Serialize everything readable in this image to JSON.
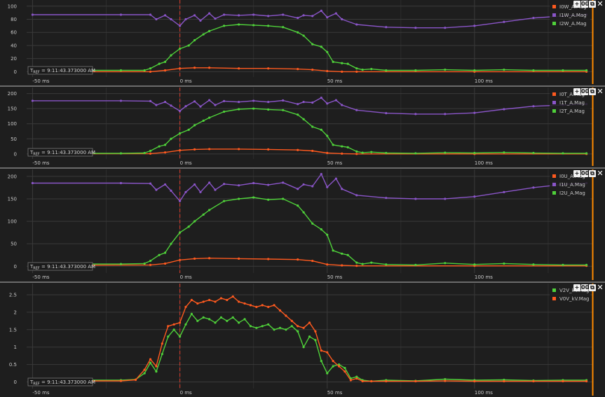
{
  "toolbar": {
    "add_label": "+",
    "layout_label": "00",
    "copy_label": "⧉",
    "close_label": "✕"
  },
  "tref_prefix": "T",
  "tref_sub": "REF",
  "tref_value": " = 9:11:43.373000 AM",
  "colors": {
    "orange": "#ff5a1f",
    "purple": "#8a55c8",
    "green": "#4fd13a",
    "cursor": "#c0392b",
    "right_edge": "#ff8a00"
  },
  "chart_data": [
    {
      "type": "line",
      "x_ticks": [
        -50,
        0,
        50,
        100
      ],
      "x_tick_labels": [
        "-50 ms",
        "0 ms",
        "50 ms",
        "100 ms"
      ],
      "xlim": [
        -52,
        140
      ],
      "ylim": [
        -6,
        103
      ],
      "y_ticks": [
        0,
        20,
        40,
        60,
        80,
        100
      ],
      "y_tick_labels": [
        "0",
        "20",
        "40",
        "60",
        "80",
        "100"
      ],
      "series": [
        {
          "name": "I0W_A.Mag",
          "color": "orange",
          "x": [
            -50,
            -10,
            -5,
            0,
            5,
            10,
            20,
            30,
            40,
            45,
            50,
            55,
            60,
            100,
            138
          ],
          "y": [
            0,
            0,
            2,
            5,
            6,
            6,
            5,
            5,
            4,
            3,
            1,
            0,
            0,
            0,
            0
          ]
        },
        {
          "name": "I1W_A.Mag",
          "color": "purple",
          "x": [
            -50,
            -20,
            -10,
            -8,
            -5,
            -3,
            0,
            2,
            5,
            7,
            10,
            12,
            15,
            20,
            25,
            30,
            35,
            40,
            42,
            45,
            48,
            50,
            53,
            55,
            60,
            70,
            80,
            90,
            100,
            110,
            120,
            130,
            138
          ],
          "y": [
            87,
            87,
            87,
            80,
            86,
            80,
            70,
            80,
            86,
            78,
            89,
            81,
            87,
            86,
            87,
            85,
            87,
            82,
            86,
            85,
            93,
            83,
            89,
            80,
            72,
            68,
            67,
            67,
            70,
            76,
            82,
            85,
            87
          ]
        },
        {
          "name": "I2W_A.Mag",
          "color": "green",
          "x": [
            -50,
            -20,
            -12,
            -10,
            -7,
            -5,
            -3,
            0,
            3,
            5,
            8,
            10,
            15,
            20,
            25,
            30,
            35,
            40,
            42,
            45,
            48,
            50,
            52,
            55,
            57,
            60,
            62,
            65,
            70,
            80,
            90,
            100,
            110,
            120,
            130,
            138
          ],
          "y": [
            2,
            2,
            2,
            5,
            12,
            15,
            25,
            35,
            40,
            48,
            57,
            62,
            70,
            72,
            71,
            70,
            68,
            60,
            55,
            42,
            38,
            30,
            15,
            13,
            12,
            5,
            3,
            4,
            2,
            2,
            3,
            2,
            3,
            2,
            2,
            2
          ]
        }
      ]
    },
    {
      "type": "line",
      "x_ticks": [
        -50,
        0,
        50,
        100
      ],
      "x_tick_labels": [
        "-50 ms",
        "0 ms",
        "50 ms",
        "100 ms"
      ],
      "xlim": [
        -52,
        140
      ],
      "ylim": [
        -12,
        206
      ],
      "y_ticks": [
        0,
        50,
        100,
        150,
        200
      ],
      "y_tick_labels": [
        "0",
        "50",
        "100",
        "150",
        "200"
      ],
      "series": [
        {
          "name": "I0T_A.Mag",
          "color": "orange",
          "x": [
            -50,
            -10,
            -5,
            0,
            5,
            10,
            20,
            30,
            40,
            45,
            50,
            55,
            60,
            100,
            138
          ],
          "y": [
            0,
            1,
            5,
            12,
            15,
            16,
            16,
            15,
            13,
            10,
            3,
            1,
            0,
            0,
            0
          ]
        },
        {
          "name": "I1T_A.Mag",
          "color": "purple",
          "x": [
            -50,
            -20,
            -10,
            -8,
            -5,
            -3,
            0,
            2,
            5,
            7,
            10,
            12,
            15,
            20,
            25,
            30,
            35,
            40,
            42,
            45,
            48,
            50,
            53,
            55,
            60,
            70,
            80,
            90,
            100,
            110,
            120,
            130,
            138
          ],
          "y": [
            176,
            176,
            175,
            162,
            172,
            160,
            142,
            158,
            174,
            157,
            178,
            162,
            175,
            172,
            176,
            172,
            177,
            165,
            172,
            170,
            186,
            167,
            178,
            162,
            145,
            135,
            132,
            132,
            136,
            148,
            158,
            162,
            165
          ]
        },
        {
          "name": "I2T_A.Mag",
          "color": "green",
          "x": [
            -50,
            -20,
            -12,
            -10,
            -7,
            -5,
            -3,
            0,
            3,
            5,
            8,
            10,
            15,
            20,
            25,
            30,
            35,
            40,
            42,
            45,
            48,
            50,
            52,
            55,
            57,
            60,
            62,
            65,
            70,
            80,
            90,
            100,
            110,
            120,
            130,
            138
          ],
          "y": [
            2,
            2,
            3,
            10,
            25,
            30,
            50,
            68,
            80,
            95,
            110,
            120,
            140,
            148,
            150,
            147,
            145,
            130,
            115,
            90,
            80,
            60,
            30,
            25,
            22,
            8,
            4,
            6,
            3,
            2,
            4,
            3,
            5,
            3,
            2,
            2
          ]
        }
      ]
    },
    {
      "type": "line",
      "x_ticks": [
        -50,
        0,
        50,
        100
      ],
      "x_tick_labels": [
        "-50 ms",
        "0 ms",
        "50 ms",
        "100 ms"
      ],
      "xlim": [
        -52,
        140
      ],
      "ylim": [
        -12,
        206
      ],
      "y_ticks": [
        0,
        50,
        100,
        150,
        200
      ],
      "y_tick_labels": [
        "0",
        "50",
        "100",
        "150",
        "200"
      ],
      "series": [
        {
          "name": "I0U_A.Mag",
          "color": "orange",
          "x": [
            -50,
            -10,
            -5,
            0,
            5,
            10,
            20,
            30,
            40,
            45,
            50,
            55,
            60,
            100,
            138
          ],
          "y": [
            2,
            3,
            6,
            14,
            17,
            18,
            17,
            16,
            15,
            12,
            4,
            2,
            1,
            1,
            1
          ]
        },
        {
          "name": "I1U_A.Mag",
          "color": "purple",
          "x": [
            -50,
            -20,
            -10,
            -8,
            -5,
            -3,
            0,
            2,
            5,
            7,
            10,
            12,
            15,
            20,
            25,
            30,
            35,
            40,
            42,
            45,
            48,
            50,
            53,
            55,
            60,
            70,
            80,
            90,
            100,
            110,
            120,
            130,
            138
          ],
          "y": [
            185,
            185,
            184,
            170,
            182,
            168,
            145,
            165,
            182,
            165,
            186,
            170,
            183,
            180,
            185,
            181,
            186,
            172,
            182,
            178,
            205,
            176,
            195,
            172,
            158,
            152,
            150,
            150,
            155,
            165,
            175,
            182,
            185
          ]
        },
        {
          "name": "I2U_A.Mag",
          "color": "green",
          "x": [
            -50,
            -20,
            -12,
            -10,
            -7,
            -5,
            -3,
            0,
            3,
            5,
            8,
            10,
            15,
            20,
            25,
            30,
            35,
            40,
            42,
            45,
            48,
            50,
            52,
            55,
            57,
            60,
            62,
            65,
            70,
            80,
            90,
            100,
            110,
            120,
            130,
            138
          ],
          "y": [
            5,
            5,
            6,
            12,
            25,
            30,
            50,
            75,
            88,
            100,
            115,
            125,
            145,
            150,
            153,
            148,
            150,
            135,
            120,
            95,
            82,
            70,
            35,
            28,
            25,
            8,
            5,
            8,
            4,
            3,
            7,
            4,
            6,
            4,
            3,
            3
          ]
        }
      ]
    },
    {
      "type": "line",
      "x_ticks": [
        -50,
        0,
        50,
        100
      ],
      "x_tick_labels": [
        "-50 ms",
        "0 ms",
        "50 ms",
        "100 ms"
      ],
      "xlim": [
        -52,
        140
      ],
      "ylim": [
        -0.15,
        2.7
      ],
      "y_ticks": [
        0,
        0.5,
        1,
        1.5,
        2,
        2.5
      ],
      "y_tick_labels": [
        "0",
        "0.5",
        "1",
        "1.5",
        "2",
        "2.5"
      ],
      "series": [
        {
          "name": "V2V_kV.Mag",
          "color": "green",
          "x": [
            -50,
            -20,
            -15,
            -12,
            -10,
            -8,
            -6,
            -4,
            -2,
            0,
            2,
            4,
            6,
            8,
            10,
            12,
            14,
            16,
            18,
            20,
            22,
            24,
            26,
            28,
            30,
            32,
            34,
            36,
            38,
            40,
            42,
            44,
            46,
            48,
            50,
            52,
            54,
            56,
            58,
            60,
            62,
            65,
            70,
            80,
            90,
            100,
            110,
            120,
            130,
            138
          ],
          "y": [
            0.05,
            0.05,
            0.07,
            0.25,
            0.55,
            0.3,
            0.8,
            1.3,
            1.5,
            1.3,
            1.65,
            1.95,
            1.75,
            1.85,
            1.8,
            1.7,
            1.85,
            1.75,
            1.85,
            1.7,
            1.8,
            1.6,
            1.55,
            1.6,
            1.65,
            1.5,
            1.55,
            1.5,
            1.6,
            1.45,
            1.0,
            1.3,
            1.2,
            0.6,
            0.25,
            0.45,
            0.5,
            0.4,
            0.1,
            0.15,
            0.05,
            0.02,
            0.05,
            0.03,
            0.08,
            0.05,
            0.06,
            0.04,
            0.05,
            0.05
          ]
        },
        {
          "name": "V0V_kV.Mag",
          "color": "orange",
          "x": [
            -50,
            -20,
            -15,
            -12,
            -10,
            -8,
            -6,
            -4,
            -2,
            0,
            2,
            4,
            6,
            8,
            10,
            12,
            14,
            16,
            18,
            20,
            22,
            24,
            26,
            28,
            30,
            32,
            34,
            36,
            38,
            40,
            42,
            44,
            46,
            48,
            50,
            52,
            54,
            56,
            58,
            60,
            62,
            65,
            70,
            80,
            90,
            100,
            110,
            120,
            130,
            138
          ],
          "y": [
            0.03,
            0.03,
            0.06,
            0.35,
            0.65,
            0.45,
            1.1,
            1.6,
            1.65,
            1.7,
            2.15,
            2.35,
            2.25,
            2.3,
            2.35,
            2.3,
            2.4,
            2.35,
            2.45,
            2.3,
            2.25,
            2.2,
            2.15,
            2.2,
            2.15,
            2.2,
            2.05,
            1.9,
            1.75,
            1.6,
            1.55,
            1.7,
            1.45,
            0.9,
            0.85,
            0.6,
            0.45,
            0.3,
            0.05,
            0.1,
            0.02,
            0.02,
            0.02,
            0.02,
            0.03,
            0.02,
            0.02,
            0.02,
            0.02,
            0.02
          ]
        }
      ]
    }
  ]
}
